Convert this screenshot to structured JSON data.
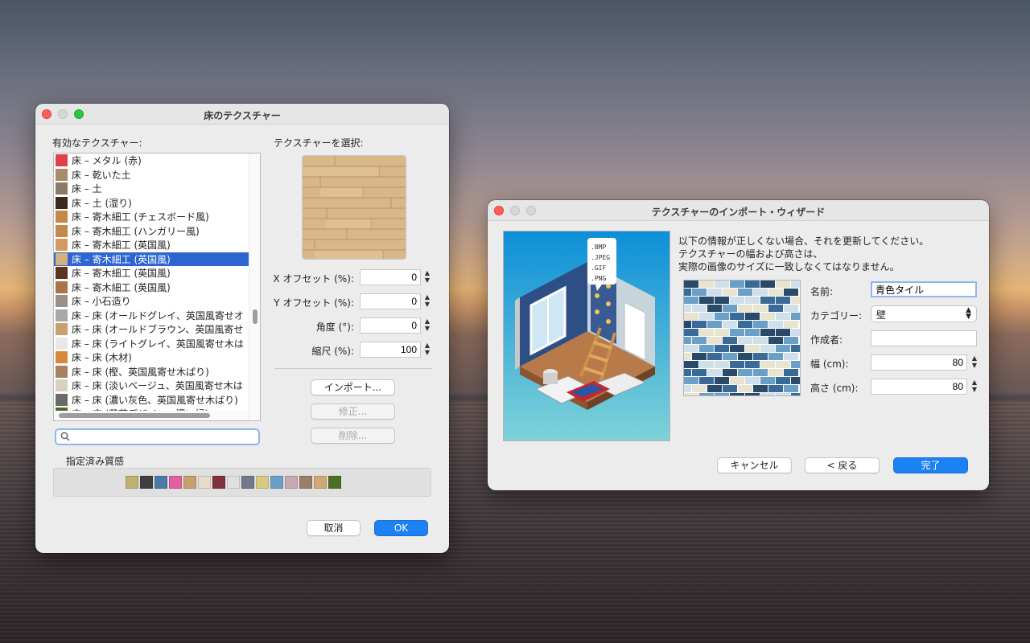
{
  "window1": {
    "title": "床のテクスチャー",
    "available_label": "有効なテクスチャー:",
    "select_label": "テクスチャーを選択:",
    "items": [
      {
        "label": "床 – メタル (赤)",
        "color": "#e0404a"
      },
      {
        "label": "床 – 乾いた土",
        "color": "#a88a6c"
      },
      {
        "label": "床 – 土",
        "color": "#8a7a6a"
      },
      {
        "label": "床 – 土 (湿り)",
        "color": "#3a2a20"
      },
      {
        "label": "床 – 寄木細工 (チェスボード風)",
        "color": "#c4884a"
      },
      {
        "label": "床 – 寄木細工 (ハンガリー風)",
        "color": "#c08a50"
      },
      {
        "label": "床 – 寄木細工 (英国風)",
        "color": "#d09a60"
      },
      {
        "label": "床 – 寄木細工 (英国風)",
        "color": "#d8b07a"
      },
      {
        "label": "床 – 寄木細工 (英国風)",
        "color": "#5a3420"
      },
      {
        "label": "床 – 寄木細工 (英国風)",
        "color": "#a87448"
      },
      {
        "label": "床 – 小石造り",
        "color": "#9a9088"
      },
      {
        "label": "床 – 床 (オールドグレイ、英国風寄せオ",
        "color": "#a8a8a8"
      },
      {
        "label": "床 – 床 (オールドブラウン、英国風寄せ",
        "color": "#c8a070"
      },
      {
        "label": "床 – 床 (ライトグレイ、英国風寄せ木は",
        "color": "#e8e8e8"
      },
      {
        "label": "床 – 床 (木材)",
        "color": "#d88838"
      },
      {
        "label": "床 – 床 (樫、英国風寄せ木ばり)",
        "color": "#a88060"
      },
      {
        "label": "床 – 床 (淡いベージュ、英国風寄せ木は",
        "color": "#d8d0c0"
      },
      {
        "label": "床 – 床 (濃い灰色、英国風寄せ木ばり)",
        "color": "#6a6a6a"
      },
      {
        "label": "床 – 床 (草花デザイン、濃い緑)",
        "color": "#4a6a2a"
      }
    ],
    "selected_index": 7,
    "search_value": "",
    "x_offset_label": "X オフセット (%):",
    "x_offset_value": "0",
    "y_offset_label": "Y オフセット (%):",
    "y_offset_value": "0",
    "angle_label": "角度 (°):",
    "angle_value": "0",
    "scale_label": "縮尺 (%):",
    "scale_value": "100",
    "import_button": "インポート...",
    "modify_button": "修正...",
    "delete_button": "削除...",
    "assigned_label": "指定済み質感",
    "assigned_colors": [
      "#c0b070",
      "#404040",
      "#4a7aa8",
      "#e060a0",
      "#c8a070",
      "#e8dcc8",
      "#803040",
      "#e0e0e0",
      "#707a88",
      "#d8c880",
      "#6aa0c8",
      "#c8a8b0",
      "#988068",
      "#d0a878",
      "#4a7020"
    ],
    "cancel_button": "取消",
    "ok_button": "OK"
  },
  "window2": {
    "title": "テクスチャーのインポート・ウィザード",
    "instruction_lines": [
      "以下の情報が正しくない場合、それを更新してください。",
      "テクスチャーの幅および高さは、",
      "実際の画像のサイズに一致しなくてはなりません。"
    ],
    "formats": [
      ".BMP",
      ".JPEG",
      ".GIF",
      ".PNG"
    ],
    "name_label": "名前:",
    "name_value": "青色タイル",
    "category_label": "カテゴリー:",
    "category_value": "壁",
    "author_label": "作成者:",
    "author_value": "",
    "width_label": "幅 (cm):",
    "width_value": "80",
    "height_label": "高さ (cm):",
    "height_value": "80",
    "cancel_button": "キャンセル",
    "back_button": "< 戻る",
    "finish_button": "完了"
  }
}
